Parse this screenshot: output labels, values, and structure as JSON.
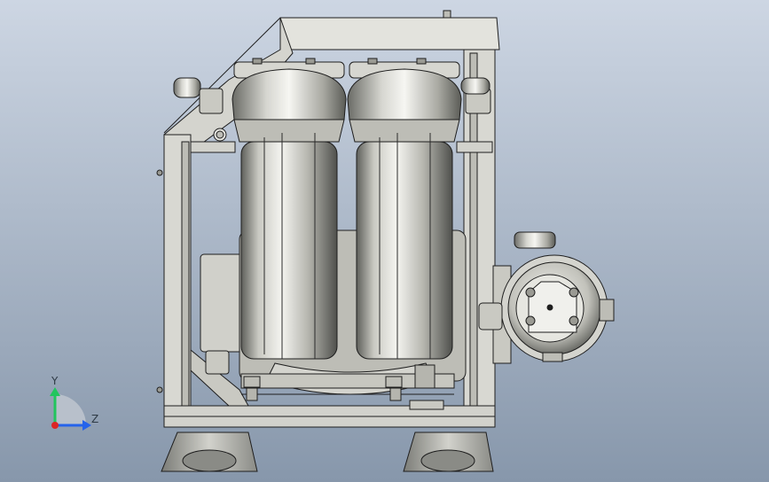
{
  "viewport": {
    "background_top": "#cdd6e3",
    "background_bottom": "#8797ab"
  },
  "model": {
    "frame_color": "#d8d8d2",
    "frame_dark": "#a9aaa3",
    "metal_light": "#f2f2ee",
    "metal_mid": "#bdbdb6",
    "metal_dark": "#6f706b",
    "edge_color": "#1e1e1e"
  },
  "triad": {
    "y_label": "Y",
    "z_label": "Z",
    "y_color": "#22c55e",
    "z_color": "#2563eb",
    "x_color": "#dc2626",
    "icon": "axis-triad-icon"
  }
}
